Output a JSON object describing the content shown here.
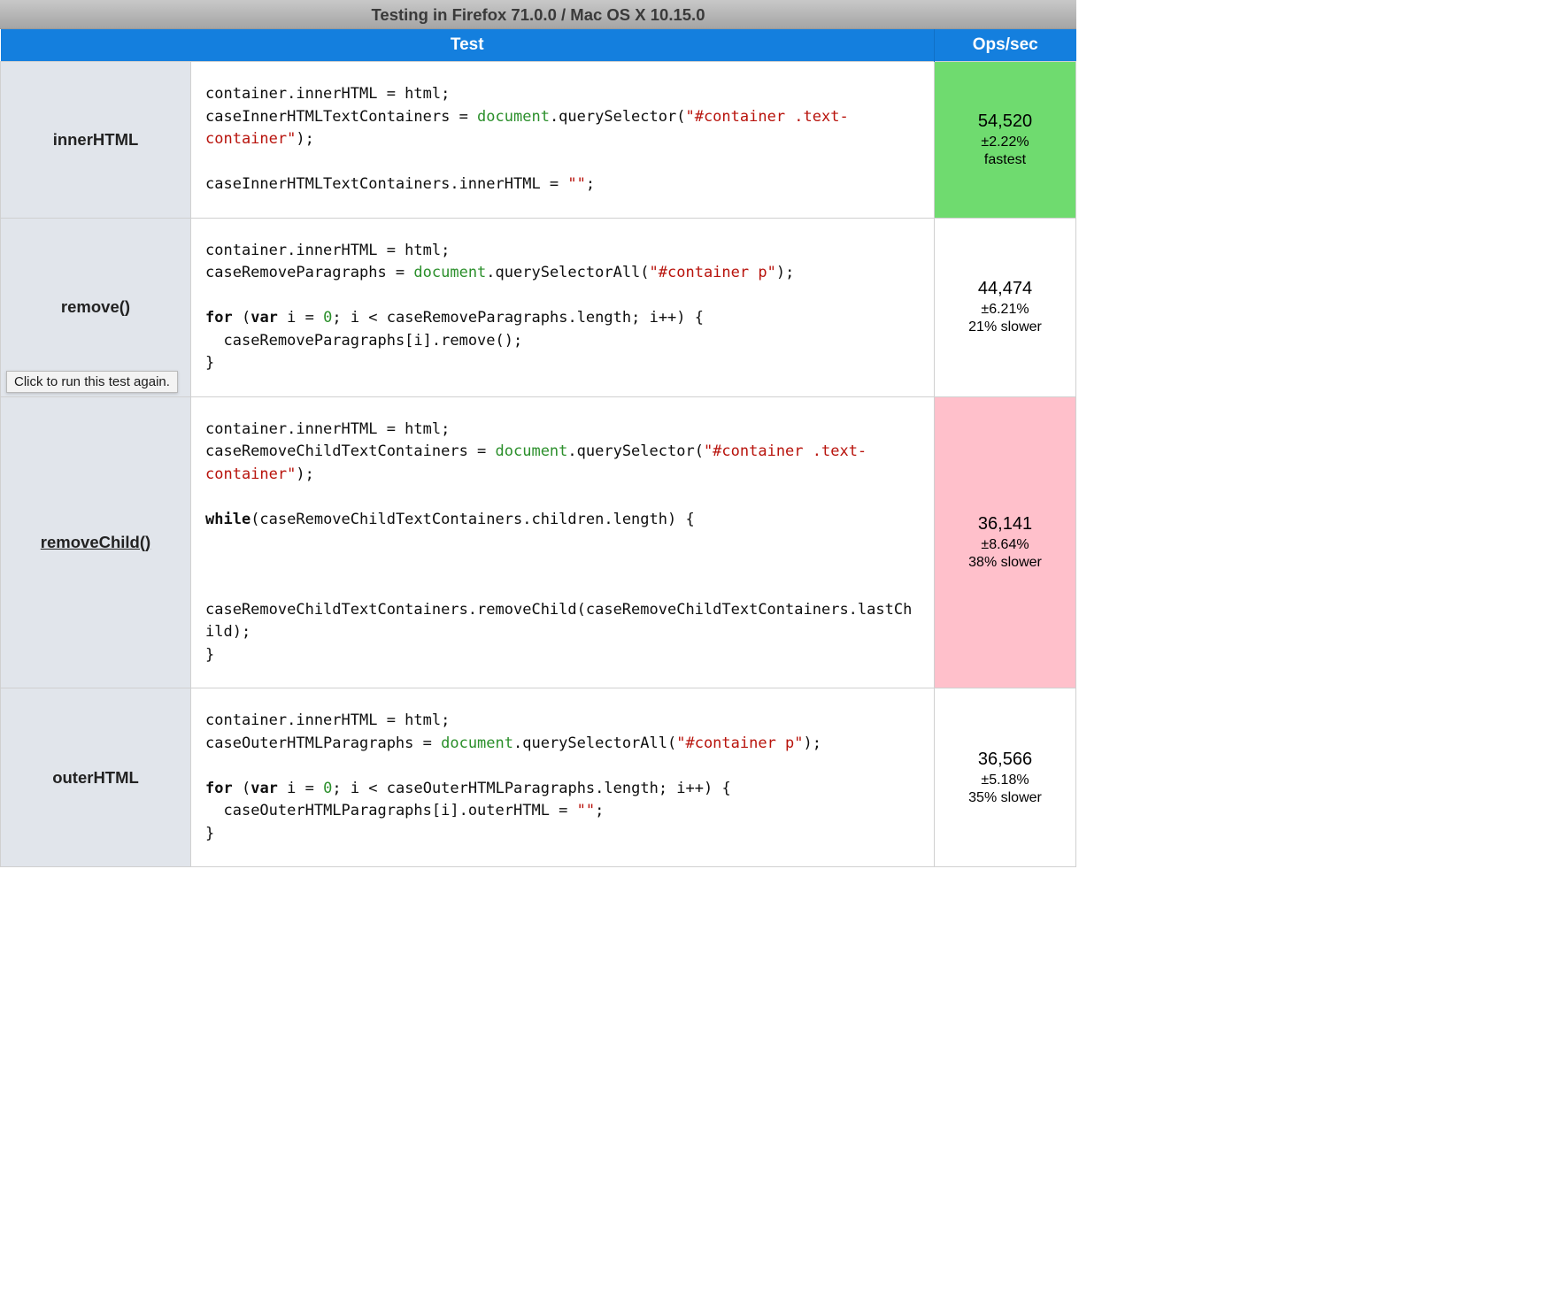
{
  "titlebar": "Testing in Firefox 71.0.0 / Mac OS X 10.15.0",
  "header": {
    "col_test": "Test",
    "col_ops": "Ops/sec"
  },
  "tooltip": "Click to run this test again.",
  "rows": [
    {
      "name": "innerHTML",
      "ops_value": "54,520",
      "ops_error": "±2.22%",
      "ops_label": "fastest",
      "ops_class": "fastest",
      "hovered": false
    },
    {
      "name": "remove()",
      "ops_value": "44,474",
      "ops_error": "±6.21%",
      "ops_label": "21% slower",
      "ops_class": "normal",
      "hovered": false
    },
    {
      "name": "removeChild()",
      "ops_value": "36,141",
      "ops_error": "±8.64%",
      "ops_label": "38% slower",
      "ops_class": "slowest",
      "hovered": true
    },
    {
      "name": "outerHTML",
      "ops_value": "36,566",
      "ops_error": "±5.18%",
      "ops_label": "35% slower",
      "ops_class": "normal",
      "hovered": false
    }
  ],
  "code_tokens": {
    "r0": [
      [
        "",
        "container.innerHTML = html;\ncaseInnerHTMLTextContainers = "
      ],
      [
        "doc",
        "document"
      ],
      [
        "",
        ".querySelector("
      ],
      [
        "str",
        "\"#container .text-container\""
      ],
      [
        "",
        ");\n\ncaseInnerHTMLTextContainers.innerHTML = "
      ],
      [
        "str",
        "\"\""
      ],
      [
        "",
        ";"
      ]
    ],
    "r1": [
      [
        "",
        "container.innerHTML = html;\ncaseRemoveParagraphs = "
      ],
      [
        "doc",
        "document"
      ],
      [
        "",
        ".querySelectorAll("
      ],
      [
        "str",
        "\"#container p\""
      ],
      [
        "",
        ");\n\n"
      ],
      [
        "kw",
        "for"
      ],
      [
        "",
        " ("
      ],
      [
        "kw",
        "var"
      ],
      [
        "",
        " i = "
      ],
      [
        "num",
        "0"
      ],
      [
        "",
        "; i < caseRemoveParagraphs.length; i++) {\n  caseRemoveParagraphs[i].remove();\n}"
      ]
    ],
    "r2": [
      [
        "",
        "container.innerHTML = html;\ncaseRemoveChildTextContainers = "
      ],
      [
        "doc",
        "document"
      ],
      [
        "",
        ".querySelector("
      ],
      [
        "str",
        "\"#container .text-container\""
      ],
      [
        "",
        ");\n\n"
      ],
      [
        "kw",
        "while"
      ],
      [
        "",
        "(caseRemoveChildTextContainers.children.length) {\n\n\n\ncaseRemoveChildTextContainers.removeChild(caseRemoveChildTextContainers.lastChild);\n}"
      ]
    ],
    "r3": [
      [
        "",
        "container.innerHTML = html;\ncaseOuterHTMLParagraphs = "
      ],
      [
        "doc",
        "document"
      ],
      [
        "",
        ".querySelectorAll("
      ],
      [
        "str",
        "\"#container p\""
      ],
      [
        "",
        ");\n\n"
      ],
      [
        "kw",
        "for"
      ],
      [
        "",
        " ("
      ],
      [
        "kw",
        "var"
      ],
      [
        "",
        " i = "
      ],
      [
        "num",
        "0"
      ],
      [
        "",
        "; i < caseOuterHTMLParagraphs.length; i++) {\n  caseOuterHTMLParagraphs[i].outerHTML = "
      ],
      [
        "str",
        "\"\""
      ],
      [
        "",
        ";\n}"
      ]
    ]
  }
}
